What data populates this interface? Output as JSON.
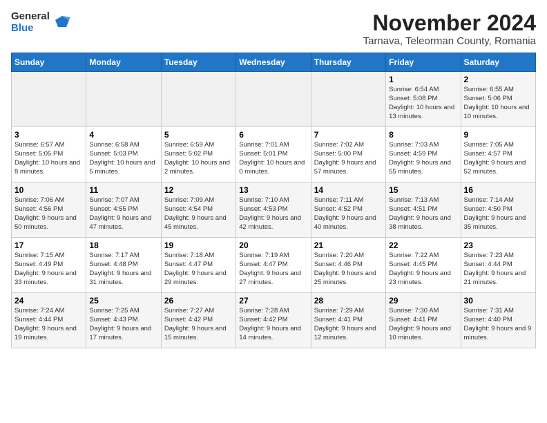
{
  "logo": {
    "general": "General",
    "blue": "Blue"
  },
  "title": "November 2024",
  "subtitle": "Tarnava, Teleorman County, Romania",
  "days_header": [
    "Sunday",
    "Monday",
    "Tuesday",
    "Wednesday",
    "Thursday",
    "Friday",
    "Saturday"
  ],
  "weeks": [
    [
      {
        "day": "",
        "info": ""
      },
      {
        "day": "",
        "info": ""
      },
      {
        "day": "",
        "info": ""
      },
      {
        "day": "",
        "info": ""
      },
      {
        "day": "",
        "info": ""
      },
      {
        "day": "1",
        "info": "Sunrise: 6:54 AM\nSunset: 5:08 PM\nDaylight: 10 hours and 13 minutes."
      },
      {
        "day": "2",
        "info": "Sunrise: 6:55 AM\nSunset: 5:06 PM\nDaylight: 10 hours and 10 minutes."
      }
    ],
    [
      {
        "day": "3",
        "info": "Sunrise: 6:57 AM\nSunset: 5:05 PM\nDaylight: 10 hours and 8 minutes."
      },
      {
        "day": "4",
        "info": "Sunrise: 6:58 AM\nSunset: 5:03 PM\nDaylight: 10 hours and 5 minutes."
      },
      {
        "day": "5",
        "info": "Sunrise: 6:59 AM\nSunset: 5:02 PM\nDaylight: 10 hours and 2 minutes."
      },
      {
        "day": "6",
        "info": "Sunrise: 7:01 AM\nSunset: 5:01 PM\nDaylight: 10 hours and 0 minutes."
      },
      {
        "day": "7",
        "info": "Sunrise: 7:02 AM\nSunset: 5:00 PM\nDaylight: 9 hours and 57 minutes."
      },
      {
        "day": "8",
        "info": "Sunrise: 7:03 AM\nSunset: 4:59 PM\nDaylight: 9 hours and 55 minutes."
      },
      {
        "day": "9",
        "info": "Sunrise: 7:05 AM\nSunset: 4:57 PM\nDaylight: 9 hours and 52 minutes."
      }
    ],
    [
      {
        "day": "10",
        "info": "Sunrise: 7:06 AM\nSunset: 4:56 PM\nDaylight: 9 hours and 50 minutes."
      },
      {
        "day": "11",
        "info": "Sunrise: 7:07 AM\nSunset: 4:55 PM\nDaylight: 9 hours and 47 minutes."
      },
      {
        "day": "12",
        "info": "Sunrise: 7:09 AM\nSunset: 4:54 PM\nDaylight: 9 hours and 45 minutes."
      },
      {
        "day": "13",
        "info": "Sunrise: 7:10 AM\nSunset: 4:53 PM\nDaylight: 9 hours and 42 minutes."
      },
      {
        "day": "14",
        "info": "Sunrise: 7:11 AM\nSunset: 4:52 PM\nDaylight: 9 hours and 40 minutes."
      },
      {
        "day": "15",
        "info": "Sunrise: 7:13 AM\nSunset: 4:51 PM\nDaylight: 9 hours and 38 minutes."
      },
      {
        "day": "16",
        "info": "Sunrise: 7:14 AM\nSunset: 4:50 PM\nDaylight: 9 hours and 35 minutes."
      }
    ],
    [
      {
        "day": "17",
        "info": "Sunrise: 7:15 AM\nSunset: 4:49 PM\nDaylight: 9 hours and 33 minutes."
      },
      {
        "day": "18",
        "info": "Sunrise: 7:17 AM\nSunset: 4:48 PM\nDaylight: 9 hours and 31 minutes."
      },
      {
        "day": "19",
        "info": "Sunrise: 7:18 AM\nSunset: 4:47 PM\nDaylight: 9 hours and 29 minutes."
      },
      {
        "day": "20",
        "info": "Sunrise: 7:19 AM\nSunset: 4:47 PM\nDaylight: 9 hours and 27 minutes."
      },
      {
        "day": "21",
        "info": "Sunrise: 7:20 AM\nSunset: 4:46 PM\nDaylight: 9 hours and 25 minutes."
      },
      {
        "day": "22",
        "info": "Sunrise: 7:22 AM\nSunset: 4:45 PM\nDaylight: 9 hours and 23 minutes."
      },
      {
        "day": "23",
        "info": "Sunrise: 7:23 AM\nSunset: 4:44 PM\nDaylight: 9 hours and 21 minutes."
      }
    ],
    [
      {
        "day": "24",
        "info": "Sunrise: 7:24 AM\nSunset: 4:44 PM\nDaylight: 9 hours and 19 minutes."
      },
      {
        "day": "25",
        "info": "Sunrise: 7:25 AM\nSunset: 4:43 PM\nDaylight: 9 hours and 17 minutes."
      },
      {
        "day": "26",
        "info": "Sunrise: 7:27 AM\nSunset: 4:42 PM\nDaylight: 9 hours and 15 minutes."
      },
      {
        "day": "27",
        "info": "Sunrise: 7:28 AM\nSunset: 4:42 PM\nDaylight: 9 hours and 14 minutes."
      },
      {
        "day": "28",
        "info": "Sunrise: 7:29 AM\nSunset: 4:41 PM\nDaylight: 9 hours and 12 minutes."
      },
      {
        "day": "29",
        "info": "Sunrise: 7:30 AM\nSunset: 4:41 PM\nDaylight: 9 hours and 10 minutes."
      },
      {
        "day": "30",
        "info": "Sunrise: 7:31 AM\nSunset: 4:40 PM\nDaylight: 9 hours and 9 minutes."
      }
    ]
  ]
}
